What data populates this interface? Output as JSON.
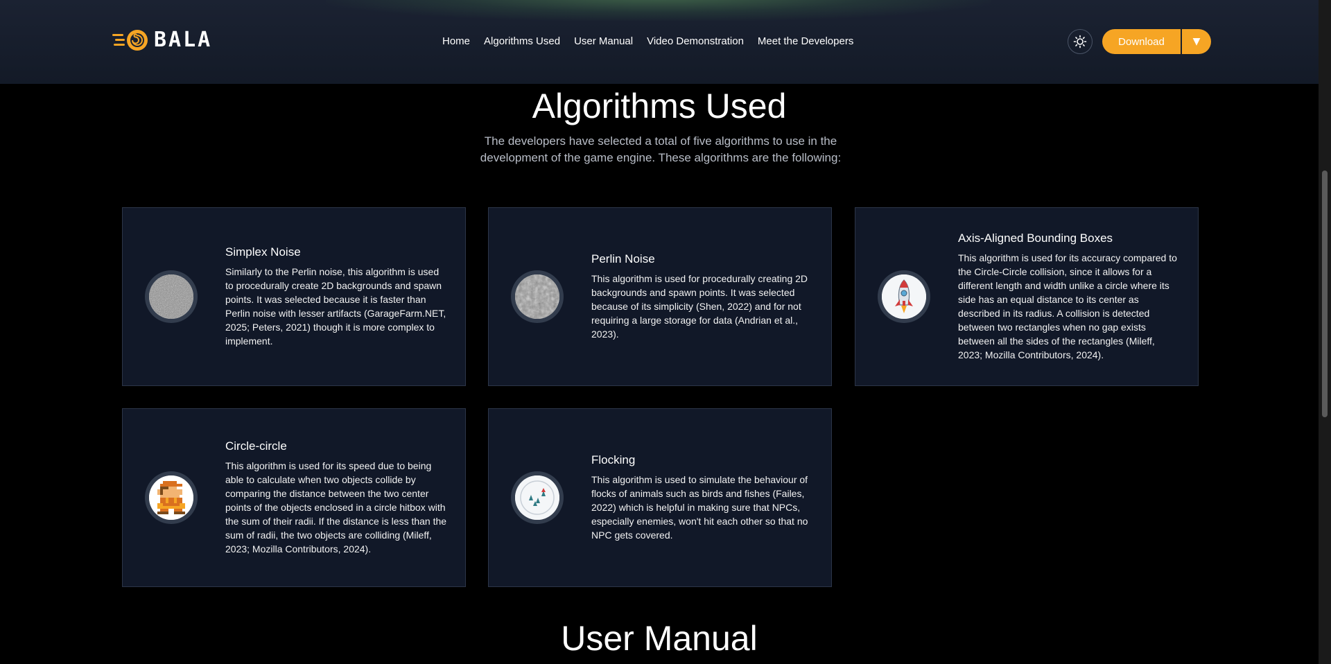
{
  "header": {
    "logo_text": "BALA",
    "nav": [
      "Home",
      "Algorithms Used",
      "User Manual",
      "Video Demonstration",
      "Meet the Developers"
    ],
    "download_label": "Download",
    "download_caret": "▼",
    "accent_color": "#f6a524"
  },
  "algorithms_section": {
    "title": "Algorithms Used",
    "intro": "The developers have selected a total of five algorithms to use in the development of the game engine. These algorithms are the following:",
    "cards": [
      {
        "title": "Simplex Noise",
        "icon": "simplex-noise-icon",
        "description": "Similarly to the Perlin noise, this algorithm is used to procedurally create 2D backgrounds and spawn points. It was selected because it is faster than Perlin noise with lesser artifacts (GarageFarm.NET, 2025; Peters, 2021) though it is more complex to implement."
      },
      {
        "title": "Perlin Noise",
        "icon": "perlin-noise-icon",
        "description": "This algorithm is used for procedurally creating 2D backgrounds and spawn points. It was selected because of its simplicity (Shen, 2022) and for not requiring a large storage for data (Andrian et al., 2023)."
      },
      {
        "title": "Axis-Aligned Bounding Boxes",
        "icon": "rocket-icon",
        "description": "This algorithm is used for its accuracy compared to the Circle-Circle collision, since it allows for a different length and width unlike a circle where its side has an equal distance to its center as described in its radius. A collision is detected between two rectangles when no gap exists between all the sides of the rectangles (Mileff, 2023; Mozilla Contributors, 2024)."
      },
      {
        "title": "Circle-circle",
        "icon": "pixel-character-icon",
        "description": "This algorithm is used for its speed due to being able to calculate when two objects collide by comparing the distance between the two center points of the objects enclosed in a circle hitbox with the sum of their radii. If the distance is less than the sum of radii, the two objects are colliding (Mileff, 2023; Mozilla Contributors, 2024)."
      },
      {
        "title": "Flocking",
        "icon": "flocking-icon",
        "description": "This algorithm is used to simulate the behaviour of flocks of animals such as birds and fishes (Failes, 2022) which is helpful in making sure that NPCs, especially enemies, won't hit each other so that no NPC gets covered."
      }
    ]
  },
  "user_manual_section": {
    "title": "User Manual"
  }
}
